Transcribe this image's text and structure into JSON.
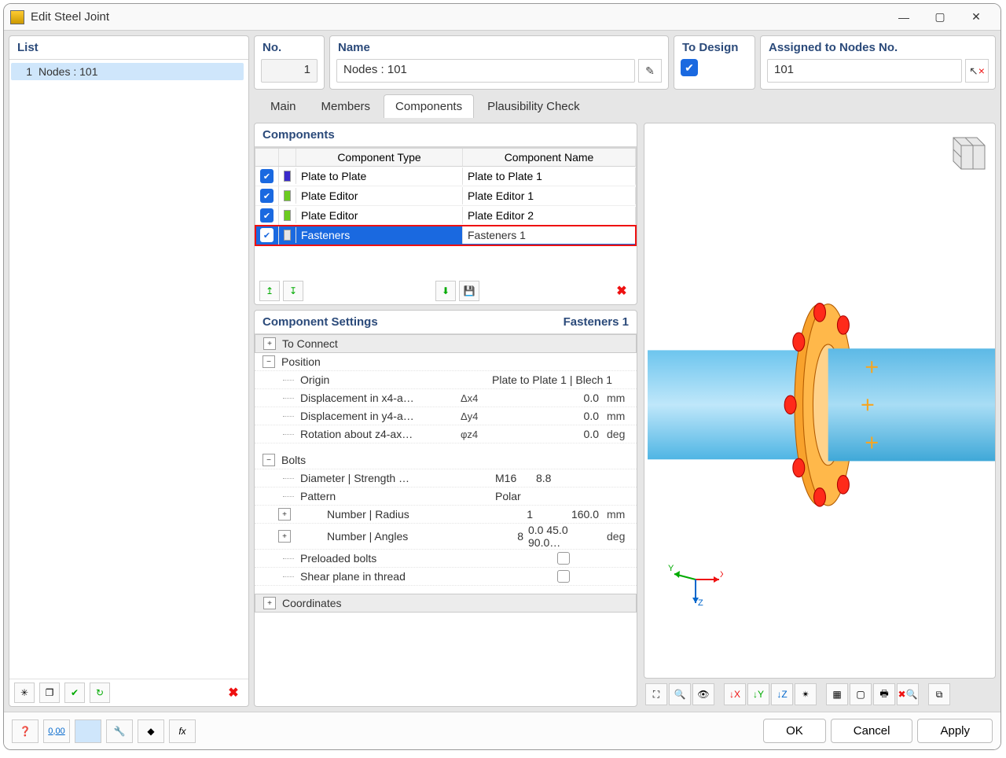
{
  "window": {
    "title": "Edit Steel Joint"
  },
  "left": {
    "header": "List",
    "item_index": "1",
    "item_label": "Nodes : 101"
  },
  "header_fields": {
    "no_label": "No.",
    "no_value": "1",
    "name_label": "Name",
    "name_value": "Nodes : 101",
    "todesign_label": "To Design",
    "nodes_label": "Assigned to Nodes No.",
    "nodes_value": "101"
  },
  "tabs": {
    "t1": "Main",
    "t2": "Members",
    "t3": "Components",
    "t4": "Plausibility Check"
  },
  "components": {
    "title": "Components",
    "col_type": "Component Type",
    "col_name": "Component Name",
    "rows": [
      {
        "type": "Plate to Plate",
        "name": "Plate to Plate 1",
        "color": "#3a2acb"
      },
      {
        "type": "Plate Editor",
        "name": "Plate Editor 1",
        "color": "#6bcb1f"
      },
      {
        "type": "Plate Editor",
        "name": "Plate Editor 2",
        "color": "#6bcb1f"
      },
      {
        "type": "Fasteners",
        "name": "Fasteners 1",
        "color": "#e6e6e6"
      }
    ]
  },
  "settings": {
    "title": "Component Settings",
    "subtitle": "Fasteners 1",
    "groups": {
      "to_connect": "To Connect",
      "position": "Position",
      "bolts": "Bolts",
      "coordinates": "Coordinates"
    },
    "position": {
      "origin_lbl": "Origin",
      "origin_val": "Plate to Plate 1 | Blech 1",
      "dx_lbl": "Displacement in x4-a…",
      "dx_sym": "Δx4",
      "dx_val": "0.0",
      "dx_unit": "mm",
      "dy_lbl": "Displacement in y4-a…",
      "dy_sym": "Δy4",
      "dy_val": "0.0",
      "dy_unit": "mm",
      "rz_lbl": "Rotation about z4-ax…",
      "rz_sym": "φz4",
      "rz_val": "0.0",
      "rz_unit": "deg"
    },
    "bolts": {
      "diam_lbl": "Diameter | Strength …",
      "diam_v1": "M16",
      "diam_v2": "8.8",
      "pattern_lbl": "Pattern",
      "pattern_val": "Polar",
      "numrad_lbl": "Number | Radius",
      "numrad_v1": "1",
      "numrad_v2": "160.0",
      "numrad_unit": "mm",
      "numang_lbl": "Number | Angles",
      "numang_v1": "8",
      "numang_v2": "0.0 45.0 90.0…",
      "numang_unit": "deg",
      "preload_lbl": "Preloaded bolts",
      "shear_lbl": "Shear plane in thread"
    }
  },
  "footer": {
    "ok": "OK",
    "cancel": "Cancel",
    "apply": "Apply"
  },
  "axes": {
    "x": "X",
    "y": "Y",
    "z": "Z"
  }
}
